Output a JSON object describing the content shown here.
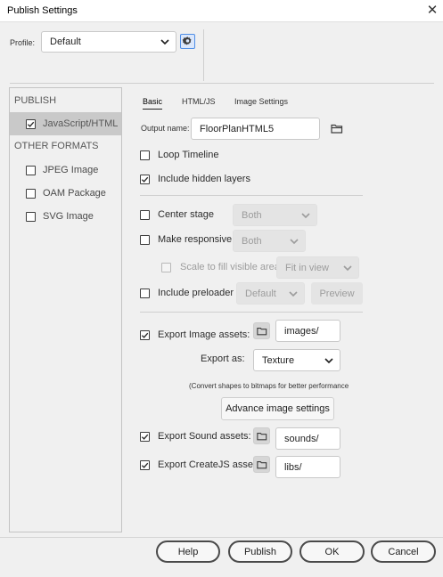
{
  "window": {
    "title": "Publish Settings",
    "close_glyph": "✕"
  },
  "profile": {
    "label": "Profile:",
    "value": "Default"
  },
  "left_panel": {
    "publish_header": "PUBLISH",
    "publish_items": [
      {
        "label": "JavaScript/HTML",
        "checked": true,
        "selected": true
      }
    ],
    "other_header": "OTHER FORMATS",
    "other_items": [
      {
        "label": "JPEG Image",
        "checked": false
      },
      {
        "label": "OAM Package",
        "checked": false
      },
      {
        "label": "SVG Image",
        "checked": false
      }
    ]
  },
  "tabs": [
    {
      "label": "Basic",
      "active": true
    },
    {
      "label": "HTML/JS",
      "active": false
    },
    {
      "label": "Image Settings",
      "active": false
    }
  ],
  "basic": {
    "output_name_label": "Output name:",
    "output_name_value": "FloorPlanHTML5",
    "loop_timeline": {
      "label": "Loop Timeline",
      "checked": false
    },
    "include_hidden_layers": {
      "label": "Include hidden layers",
      "checked": true
    },
    "center_stage": {
      "label": "Center stage",
      "checked": false,
      "value": "Both"
    },
    "make_responsive": {
      "label": "Make responsive",
      "checked": false,
      "value": "Both"
    },
    "scale_to_fill": {
      "label": "Scale to fill visible area",
      "checked": false,
      "value": "Fit in view"
    },
    "include_preloader": {
      "label": "Include preloader",
      "checked": false,
      "value": "Default",
      "preview_label": "Preview"
    },
    "export_image_assets": {
      "label": "Export Image assets:",
      "checked": true,
      "path": "images/"
    },
    "export_as": {
      "label": "Export as:",
      "value": "Texture"
    },
    "convert_note": "(Convert shapes to bitmaps for better performance",
    "advance_button": "Advance image settings",
    "export_sound_assets": {
      "label": "Export Sound assets:",
      "checked": true,
      "path": "sounds/"
    },
    "export_createjs_assets": {
      "label": "Export CreateJS assets:",
      "checked": true,
      "path": "libs/"
    }
  },
  "footer": {
    "help": "Help",
    "publish": "Publish",
    "ok": "OK",
    "cancel": "Cancel"
  },
  "icons": {
    "close": "close-icon",
    "gear": "gear-icon",
    "folder": "folder-icon",
    "chevron": "chevron-down-icon",
    "check": "checkmark-icon"
  }
}
